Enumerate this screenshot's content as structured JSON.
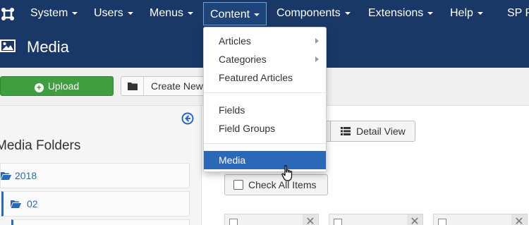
{
  "nav": {
    "items": [
      {
        "label": "System"
      },
      {
        "label": "Users"
      },
      {
        "label": "Menus"
      },
      {
        "label": "Content"
      },
      {
        "label": "Components"
      },
      {
        "label": "Extensions"
      },
      {
        "label": "Help"
      },
      {
        "label": "SP P"
      }
    ]
  },
  "header": {
    "title": "Media"
  },
  "toolbar": {
    "upload_label": "Upload",
    "create_folder_label": "Create New F"
  },
  "sidebar": {
    "heading": "Media Folders",
    "folders": [
      {
        "label": "2018"
      },
      {
        "label": "02"
      }
    ]
  },
  "main": {
    "detail_view_label": "Detail View",
    "check_all_label": "Check All Items",
    "close_glyph": "✕"
  },
  "dropdown": {
    "items": [
      {
        "label": "Articles"
      },
      {
        "label": "Categories"
      },
      {
        "label": "Featured Articles"
      },
      {
        "label": "Fields"
      },
      {
        "label": "Field Groups"
      },
      {
        "label": "Media"
      }
    ],
    "selected": "Media"
  },
  "colors": {
    "nav_bg": "#1a3867",
    "accent": "#2a69b8",
    "upload_green": "#3f9e3f"
  },
  "icons": [
    "joomla-logo-icon",
    "media-image-icon",
    "plus-circle-icon",
    "folder-icon",
    "folder-open-icon",
    "arrow-left-circle-icon",
    "list-icon",
    "checkbox-icon",
    "close-icon",
    "chevron-right-icon",
    "hand-pointer-icon"
  ]
}
